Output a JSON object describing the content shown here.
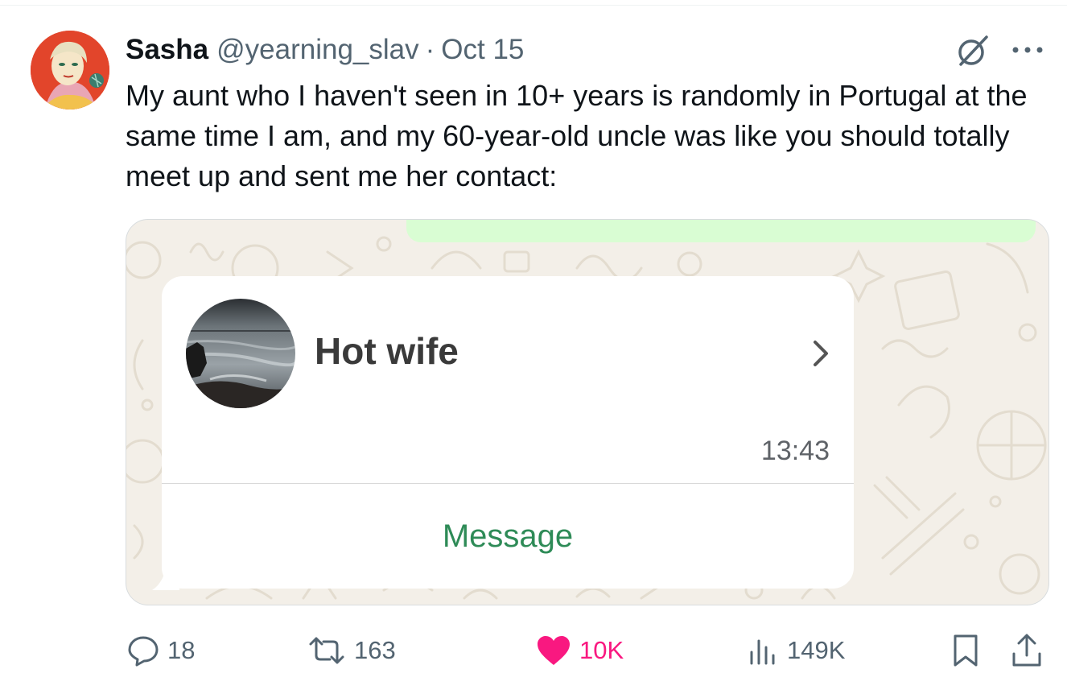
{
  "tweet": {
    "author_name": "Sasha",
    "handle": "@yearning_slav",
    "separator": "·",
    "date": "Oct 15",
    "text": "My aunt who I haven't seen in 10+ years is randomly in Portugal at the same time I am, and my 60-year-old uncle was like you should totally meet up and sent me her contact:"
  },
  "contact_card": {
    "name": "Hot wife",
    "time": "13:43",
    "message_button": "Message"
  },
  "actions": {
    "replies": "18",
    "reposts": "163",
    "likes": "10K",
    "views": "149K"
  },
  "colors": {
    "like_active": "#f91880",
    "text_secondary": "#536471",
    "whatsapp_green": "#2e8b57",
    "outgoing_bubble": "#d9fdd3",
    "chat_wallpaper": "#f3efe8"
  },
  "icons": {
    "grok": "grok-icon",
    "more": "more-options-icon",
    "reply": "reply-icon",
    "repost": "repost-icon",
    "like": "heart-icon",
    "views": "views-icon",
    "bookmark": "bookmark-icon",
    "share": "share-icon",
    "chevron": "chevron-right-icon"
  }
}
